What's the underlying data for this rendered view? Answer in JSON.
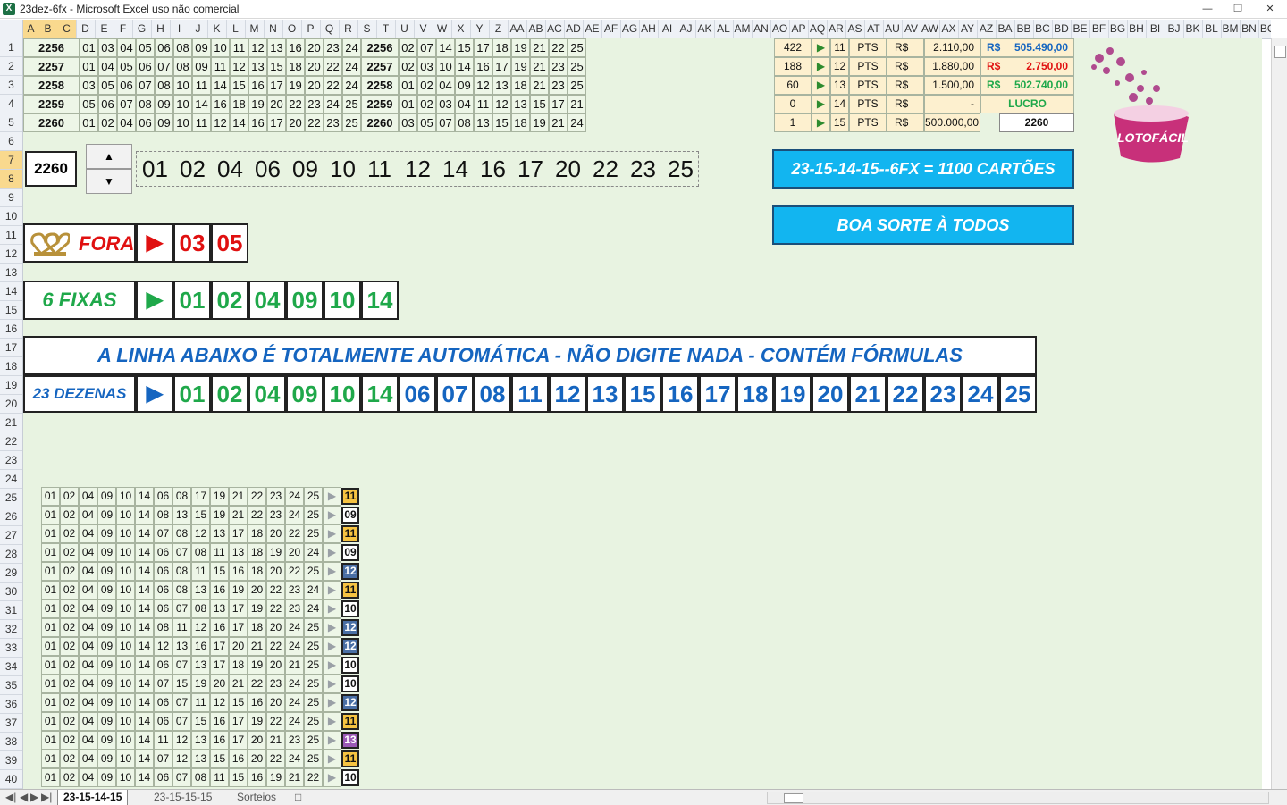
{
  "window": {
    "title": "23dez-6fx - Microsoft Excel uso não comercial",
    "icon": "excel-icon"
  },
  "columns": [
    "A",
    "B",
    "C",
    "D",
    "E",
    "F",
    "G",
    "H",
    "I",
    "J",
    "K",
    "L",
    "M",
    "N",
    "O",
    "P",
    "Q",
    "R",
    "S",
    "T",
    "U",
    "V",
    "W",
    "X",
    "Y",
    "Z",
    "AA",
    "AB",
    "AC",
    "AD",
    "AE",
    "AF",
    "AG",
    "AH",
    "AI",
    "AJ",
    "AK",
    "AL",
    "AM",
    "AN",
    "AO",
    "AP",
    "AQ",
    "AR",
    "AS",
    "AT",
    "AU",
    "AV",
    "AW",
    "AX",
    "AY",
    "AZ",
    "BA",
    "BB",
    "BC",
    "BD",
    "BE",
    "BF",
    "BG",
    "BH",
    "BI",
    "BJ",
    "BK",
    "BL",
    "BM",
    "BN",
    "BO"
  ],
  "rows": [
    "1",
    "2",
    "3",
    "4",
    "5",
    "6",
    "7",
    "8",
    "9",
    "10",
    "11",
    "12",
    "13",
    "14",
    "15",
    "16",
    "17",
    "18",
    "19",
    "20",
    "21",
    "22",
    "23",
    "24",
    "25",
    "26",
    "27",
    "28",
    "29",
    "30",
    "31",
    "32",
    "33",
    "34",
    "35",
    "36",
    "37",
    "38",
    "39",
    "40"
  ],
  "draws": [
    {
      "id": "2256",
      "a": [
        "01",
        "03",
        "04",
        "05",
        "06",
        "08",
        "09",
        "10",
        "11",
        "12",
        "13",
        "16",
        "20",
        "23",
        "24"
      ],
      "id2": "2256",
      "b": [
        "02",
        "07",
        "14",
        "15",
        "17",
        "18",
        "19",
        "21",
        "22",
        "25"
      ]
    },
    {
      "id": "2257",
      "a": [
        "01",
        "04",
        "05",
        "06",
        "07",
        "08",
        "09",
        "11",
        "12",
        "13",
        "15",
        "18",
        "20",
        "22",
        "24"
      ],
      "id2": "2257",
      "b": [
        "02",
        "03",
        "10",
        "14",
        "16",
        "17",
        "19",
        "21",
        "23",
        "25"
      ]
    },
    {
      "id": "2258",
      "a": [
        "03",
        "05",
        "06",
        "07",
        "08",
        "10",
        "11",
        "14",
        "15",
        "16",
        "17",
        "19",
        "20",
        "22",
        "24"
      ],
      "id2": "2258",
      "b": [
        "01",
        "02",
        "04",
        "09",
        "12",
        "13",
        "18",
        "21",
        "23",
        "25"
      ]
    },
    {
      "id": "2259",
      "a": [
        "05",
        "06",
        "07",
        "08",
        "09",
        "10",
        "14",
        "16",
        "18",
        "19",
        "20",
        "22",
        "23",
        "24",
        "25"
      ],
      "id2": "2259",
      "b": [
        "01",
        "02",
        "03",
        "04",
        "11",
        "12",
        "13",
        "15",
        "17",
        "21"
      ]
    },
    {
      "id": "2260",
      "a": [
        "01",
        "02",
        "04",
        "06",
        "09",
        "10",
        "11",
        "12",
        "14",
        "16",
        "17",
        "20",
        "22",
        "23",
        "25"
      ],
      "id2": "2260",
      "b": [
        "03",
        "05",
        "07",
        "08",
        "13",
        "15",
        "18",
        "19",
        "21",
        "24"
      ]
    }
  ],
  "prizes": [
    {
      "count": "422",
      "pts": "11",
      "label": "PTS",
      "cur": "R$",
      "value": "2.110,00",
      "total_cur": "R$",
      "total": "505.490,00",
      "total_color": "#1565c0"
    },
    {
      "count": "188",
      "pts": "12",
      "label": "PTS",
      "cur": "R$",
      "value": "1.880,00",
      "total_cur": "R$",
      "total": "2.750,00",
      "total_color": "#e01010"
    },
    {
      "count": "60",
      "pts": "13",
      "label": "PTS",
      "cur": "R$",
      "value": "1.500,00",
      "total_cur": "R$",
      "total": "502.740,00",
      "total_color": "#1fa84a"
    },
    {
      "count": "0",
      "pts": "14",
      "label": "PTS",
      "cur": "R$",
      "value": "-",
      "total_cur": "",
      "total": "LUCRO",
      "total_color": "#1fa84a"
    },
    {
      "count": "1",
      "pts": "15",
      "label": "PTS",
      "cur": "R$",
      "value": "500.000,00",
      "total_cur": "",
      "total": "2260",
      "total_color": "#111"
    }
  ],
  "contest": {
    "number": "2260",
    "numbers": [
      "01",
      "02",
      "04",
      "06",
      "09",
      "10",
      "11",
      "12",
      "14",
      "16",
      "17",
      "20",
      "22",
      "23",
      "25"
    ]
  },
  "banner1": "23-15-14-15--6FX  =  1100 CARTÕES",
  "banner2": "BOA  SORTE  À  TODOS",
  "logo_text": "LOTOFÁCIL",
  "fora": {
    "label": "FORA",
    "numbers": [
      "03",
      "05"
    ]
  },
  "fixas": {
    "label": "6  FIXAS",
    "numbers": [
      "01",
      "02",
      "04",
      "09",
      "10",
      "14"
    ]
  },
  "auto_line": "A  LINHA  ABAIXO  É  TOTALMENTE  AUTOMÁTICA  -  NÃO  DIGITE  NADA  -  CONTÉM  FÓRMULAS",
  "dezenas": {
    "label": "23 DEZENAS",
    "fixed": [
      "01",
      "02",
      "04",
      "09",
      "10",
      "14"
    ],
    "rest": [
      "06",
      "07",
      "08",
      "11",
      "12",
      "13",
      "15",
      "16",
      "17",
      "18",
      "19",
      "20",
      "21",
      "22",
      "23",
      "24",
      "25"
    ]
  },
  "cards": [
    {
      "n": [
        "01",
        "02",
        "04",
        "09",
        "10",
        "14",
        "06",
        "08",
        "17",
        "19",
        "21",
        "22",
        "23",
        "24",
        "25"
      ],
      "hits": "11",
      "color": "#f6c342"
    },
    {
      "n": [
        "01",
        "02",
        "04",
        "09",
        "10",
        "14",
        "08",
        "13",
        "15",
        "19",
        "21",
        "22",
        "23",
        "24",
        "25"
      ],
      "hits": "09",
      "color": "#ffffff"
    },
    {
      "n": [
        "01",
        "02",
        "04",
        "09",
        "10",
        "14",
        "07",
        "08",
        "12",
        "13",
        "17",
        "18",
        "20",
        "22",
        "25"
      ],
      "hits": "11",
      "color": "#f6c342"
    },
    {
      "n": [
        "01",
        "02",
        "04",
        "09",
        "10",
        "14",
        "06",
        "07",
        "08",
        "11",
        "13",
        "18",
        "19",
        "20",
        "24"
      ],
      "hits": "09",
      "color": "#ffffff"
    },
    {
      "n": [
        "01",
        "02",
        "04",
        "09",
        "10",
        "14",
        "06",
        "08",
        "11",
        "15",
        "16",
        "18",
        "20",
        "22",
        "25"
      ],
      "hits": "12",
      "color": "#4a6fa5"
    },
    {
      "n": [
        "01",
        "02",
        "04",
        "09",
        "10",
        "14",
        "06",
        "08",
        "13",
        "16",
        "19",
        "20",
        "22",
        "23",
        "24"
      ],
      "hits": "11",
      "color": "#f6c342"
    },
    {
      "n": [
        "01",
        "02",
        "04",
        "09",
        "10",
        "14",
        "06",
        "07",
        "08",
        "13",
        "17",
        "19",
        "22",
        "23",
        "24"
      ],
      "hits": "10",
      "color": "#ffffff"
    },
    {
      "n": [
        "01",
        "02",
        "04",
        "09",
        "10",
        "14",
        "08",
        "11",
        "12",
        "16",
        "17",
        "18",
        "20",
        "24",
        "25"
      ],
      "hits": "12",
      "color": "#4a6fa5"
    },
    {
      "n": [
        "01",
        "02",
        "04",
        "09",
        "10",
        "14",
        "12",
        "13",
        "16",
        "17",
        "20",
        "21",
        "22",
        "24",
        "25"
      ],
      "hits": "12",
      "color": "#4a6fa5"
    },
    {
      "n": [
        "01",
        "02",
        "04",
        "09",
        "10",
        "14",
        "06",
        "07",
        "13",
        "17",
        "18",
        "19",
        "20",
        "21",
        "25"
      ],
      "hits": "10",
      "color": "#ffffff"
    },
    {
      "n": [
        "01",
        "02",
        "04",
        "09",
        "10",
        "14",
        "07",
        "15",
        "19",
        "20",
        "21",
        "22",
        "23",
        "24",
        "25"
      ],
      "hits": "10",
      "color": "#ffffff"
    },
    {
      "n": [
        "01",
        "02",
        "04",
        "09",
        "10",
        "14",
        "06",
        "07",
        "11",
        "12",
        "15",
        "16",
        "20",
        "24",
        "25"
      ],
      "hits": "12",
      "color": "#4a6fa5"
    },
    {
      "n": [
        "01",
        "02",
        "04",
        "09",
        "10",
        "14",
        "06",
        "07",
        "15",
        "16",
        "17",
        "19",
        "22",
        "24",
        "25"
      ],
      "hits": "11",
      "color": "#f6c342"
    },
    {
      "n": [
        "01",
        "02",
        "04",
        "09",
        "10",
        "14",
        "11",
        "12",
        "13",
        "16",
        "17",
        "20",
        "21",
        "23",
        "25"
      ],
      "hits": "13",
      "color": "#9b59b6"
    },
    {
      "n": [
        "01",
        "02",
        "04",
        "09",
        "10",
        "14",
        "07",
        "12",
        "13",
        "15",
        "16",
        "20",
        "22",
        "24",
        "25"
      ],
      "hits": "11",
      "color": "#f6c342"
    },
    {
      "n": [
        "01",
        "02",
        "04",
        "09",
        "10",
        "14",
        "06",
        "07",
        "08",
        "11",
        "15",
        "16",
        "19",
        "21",
        "22"
      ],
      "hits": "10",
      "color": "#ffffff"
    }
  ],
  "tabs": [
    "23-15-14-15",
    "23-15-15-15",
    "Sorteios"
  ]
}
